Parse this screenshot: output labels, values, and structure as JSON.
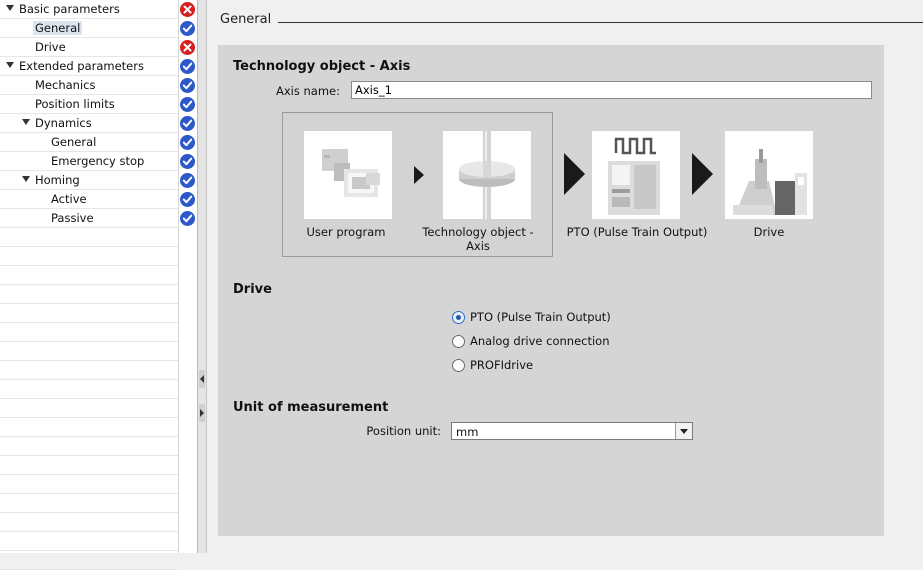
{
  "tree": [
    {
      "label": "Basic parameters",
      "level": 0,
      "expanded": true,
      "status": "error",
      "selected": false
    },
    {
      "label": "General",
      "level": 1,
      "expanded": null,
      "status": "ok",
      "selected": true
    },
    {
      "label": "Drive",
      "level": 1,
      "expanded": null,
      "status": "error",
      "selected": false
    },
    {
      "label": "Extended parameters",
      "level": 0,
      "expanded": true,
      "status": "ok",
      "selected": false
    },
    {
      "label": "Mechanics",
      "level": 1,
      "expanded": null,
      "status": "ok",
      "selected": false
    },
    {
      "label": "Position limits",
      "level": 1,
      "expanded": null,
      "status": "ok",
      "selected": false
    },
    {
      "label": "Dynamics",
      "level": 1,
      "expanded": true,
      "status": "ok",
      "selected": false
    },
    {
      "label": "General",
      "level": 2,
      "expanded": null,
      "status": "ok",
      "selected": false
    },
    {
      "label": "Emergency stop",
      "level": 2,
      "expanded": null,
      "status": "ok",
      "selected": false
    },
    {
      "label": "Homing",
      "level": 1,
      "expanded": true,
      "status": "ok",
      "selected": false
    },
    {
      "label": "Active",
      "level": 2,
      "expanded": null,
      "status": "ok",
      "selected": false
    },
    {
      "label": "Passive",
      "level": 2,
      "expanded": null,
      "status": "ok",
      "selected": false
    }
  ],
  "main": {
    "section_title": "General",
    "tech_object": {
      "heading": "Technology object - Axis",
      "axis_name_label": "Axis name:",
      "axis_name_value": "Axis_1"
    },
    "diagram": {
      "user_program": "User program",
      "tech_object_line1": "Technology object -",
      "tech_object_line2": "Axis",
      "pto": "PTO (Pulse Train Output)",
      "drive": "Drive"
    },
    "drive": {
      "heading": "Drive",
      "options": [
        {
          "label": "PTO (Pulse Train Output)",
          "checked": true
        },
        {
          "label": "Analog drive connection",
          "checked": false
        },
        {
          "label": "PROFIdrive",
          "checked": false
        }
      ]
    },
    "unit": {
      "heading": "Unit of measurement",
      "position_unit_label": "Position unit:",
      "position_unit_value": "mm"
    }
  },
  "colors": {
    "error": "#d62020",
    "ok": "#2c58c8",
    "panel": "#d5d5d5",
    "selection": "#dbe4ef"
  }
}
